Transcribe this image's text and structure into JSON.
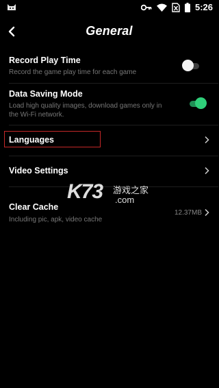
{
  "statusbar": {
    "time": "5:26"
  },
  "header": {
    "title": "General"
  },
  "settings": {
    "record_play_time": {
      "title": "Record Play Time",
      "subtitle": "Record the game play time for each game",
      "enabled": false
    },
    "data_saving_mode": {
      "title": "Data Saving Mode",
      "subtitle_line1": "Load high quality images, download games only in",
      "subtitle_line2": "the Wi-Fi network.",
      "enabled": true
    },
    "languages": {
      "title": "Languages"
    },
    "video_settings": {
      "title": "Video Settings"
    },
    "clear_cache": {
      "title": "Clear Cache",
      "subtitle": "Including pic, apk, video cache",
      "size": "12.37MB"
    }
  },
  "watermark": {
    "logo": "K73",
    "chinese": "游戏之家",
    "domain": ".com"
  },
  "colors": {
    "background": "#000000",
    "toggle_on": "#2fd07a",
    "highlight": "#c62828"
  }
}
